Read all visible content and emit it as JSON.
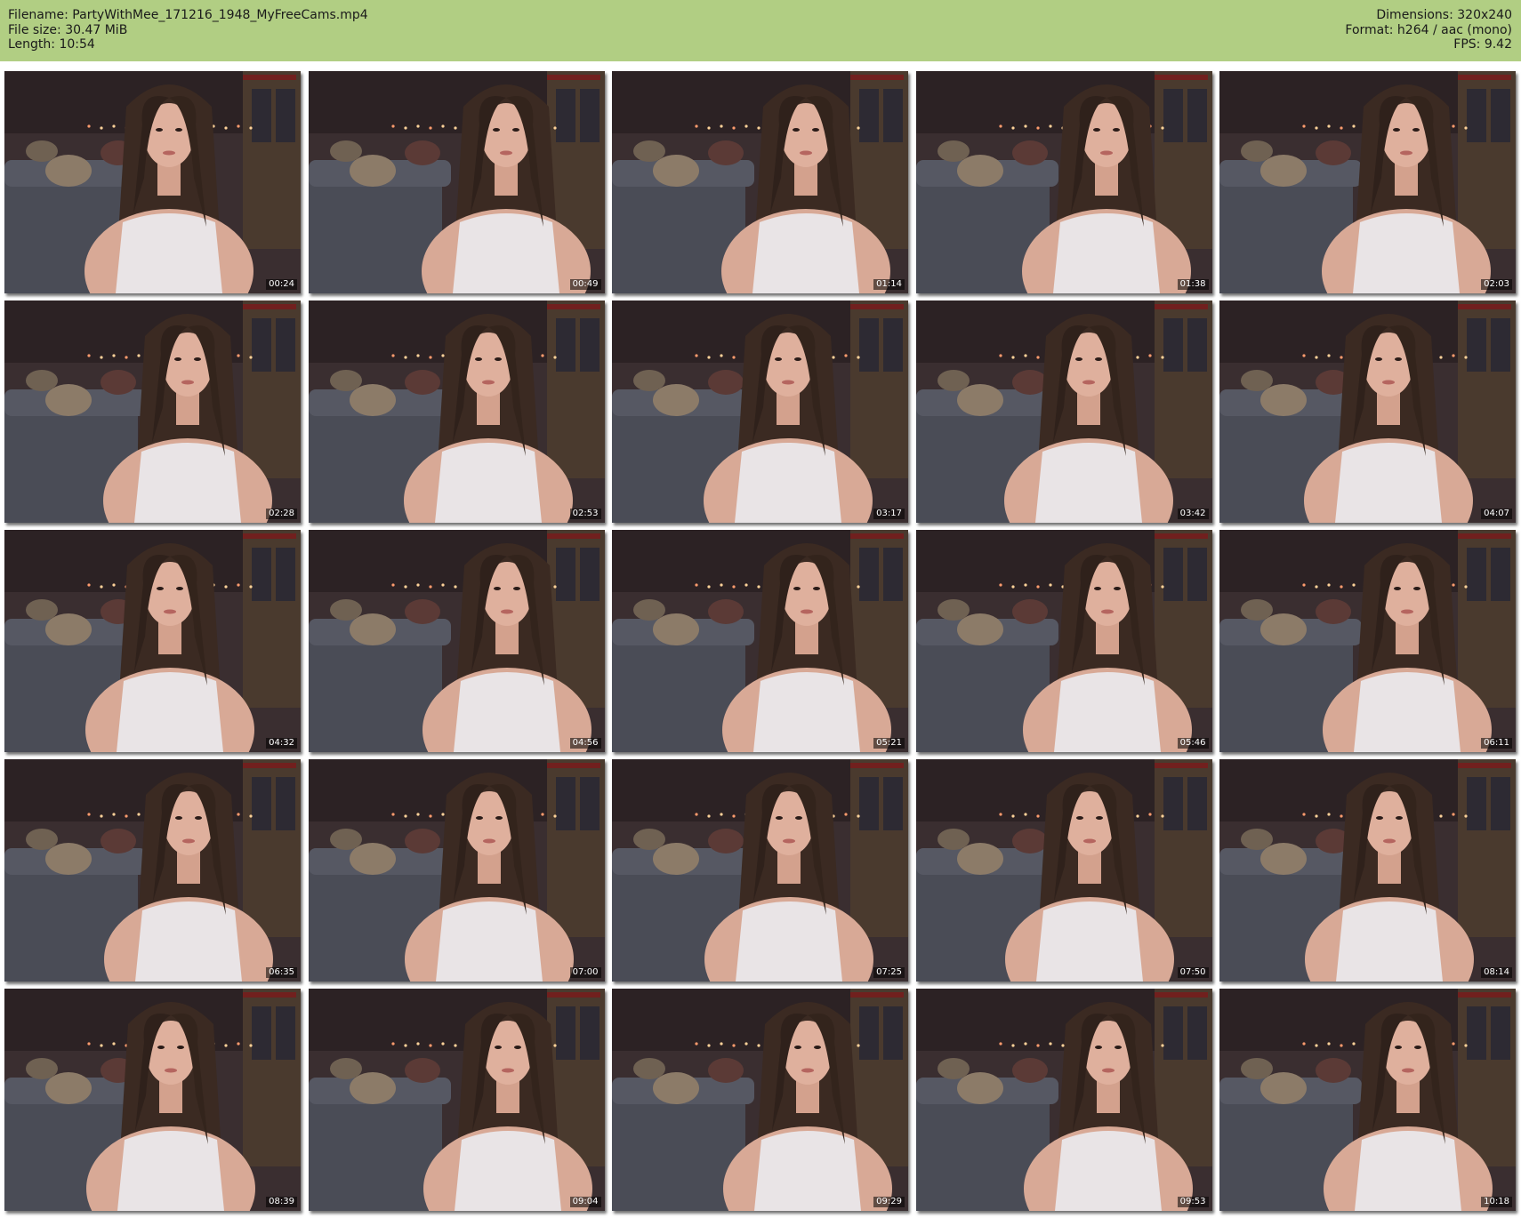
{
  "file_info": {
    "filename_line": "Filename: PartyWithMee_171216_1948_MyFreeCams.mp4",
    "filesize_line": "File size: 30.47 MiB",
    "length_line": "Length: 10:54",
    "dimensions_line": "Dimensions: 320x240",
    "format_line": "Format: h264 / aac (mono)",
    "fps_line": "FPS: 9.42"
  },
  "colors": {
    "header_background": "#b1ce83",
    "page_background": "#ffffff",
    "timestamp_text": "#ffffff"
  },
  "thumbnails": [
    {
      "timestamp": "00:24"
    },
    {
      "timestamp": "00:49"
    },
    {
      "timestamp": "01:14"
    },
    {
      "timestamp": "01:38"
    },
    {
      "timestamp": "02:03"
    },
    {
      "timestamp": "02:28"
    },
    {
      "timestamp": "02:53"
    },
    {
      "timestamp": "03:17"
    },
    {
      "timestamp": "03:42"
    },
    {
      "timestamp": "04:07"
    },
    {
      "timestamp": "04:32"
    },
    {
      "timestamp": "04:56"
    },
    {
      "timestamp": "05:21"
    },
    {
      "timestamp": "05:46"
    },
    {
      "timestamp": "06:11"
    },
    {
      "timestamp": "06:35"
    },
    {
      "timestamp": "07:00"
    },
    {
      "timestamp": "07:25"
    },
    {
      "timestamp": "07:50"
    },
    {
      "timestamp": "08:14"
    },
    {
      "timestamp": "08:39"
    },
    {
      "timestamp": "09:04"
    },
    {
      "timestamp": "09:29"
    },
    {
      "timestamp": "09:53"
    },
    {
      "timestamp": "10:18"
    }
  ]
}
